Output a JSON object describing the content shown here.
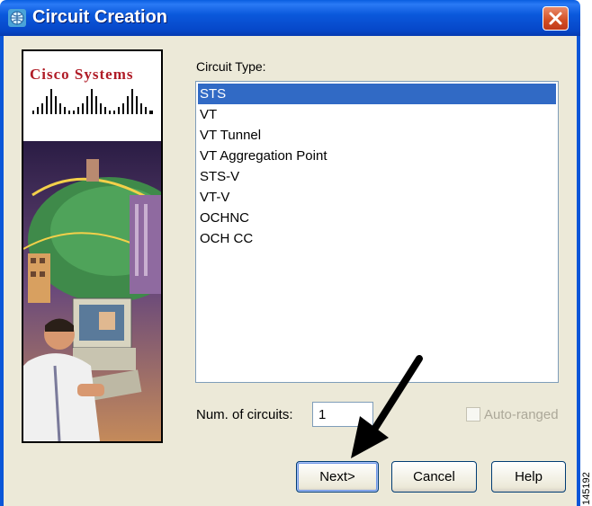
{
  "window": {
    "title": "Circuit Creation"
  },
  "logo": {
    "text": "Cisco Systems"
  },
  "circuit_type": {
    "label": "Circuit Type:",
    "items": [
      "STS",
      "VT",
      "VT Tunnel",
      "VT Aggregation Point",
      "STS-V",
      "VT-V",
      "OCHNC",
      "OCH CC"
    ],
    "selected": "STS"
  },
  "num_circuits": {
    "label": "Num. of circuits:",
    "value": "1"
  },
  "auto_ranged": {
    "label": "Auto-ranged",
    "checked": false,
    "enabled": false
  },
  "buttons": {
    "next": "Next>",
    "cancel": "Cancel",
    "help": "Help"
  },
  "figure_number": "145192",
  "colors": {
    "title_bar": "#0a5ee0",
    "selection": "#316ac5",
    "dialog_bg": "#ece9d8",
    "logo_red": "#b01c27"
  },
  "icons": {
    "app": "cisco-globe-icon",
    "close": "close-icon",
    "annotation": "arrow-pointer"
  }
}
